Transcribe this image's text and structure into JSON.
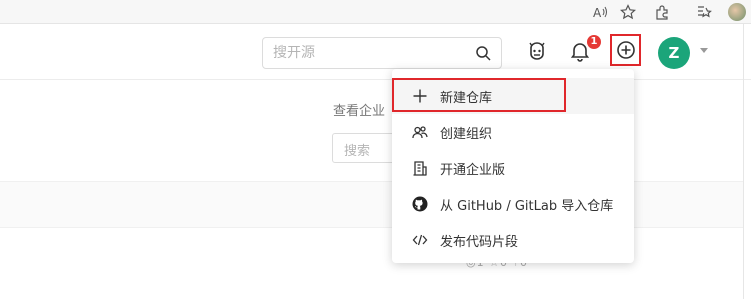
{
  "header": {
    "search_placeholder": "搜开源",
    "notification_count": "1",
    "user_initial": "Z"
  },
  "background": {
    "hint_text": "查看企业",
    "search_placeholder": "搜索",
    "stats": "◎1  ☆0  ⑂0"
  },
  "dropdown": {
    "items": [
      {
        "icon": "plus-icon",
        "label": "新建仓库"
      },
      {
        "icon": "people-icon",
        "label": "创建组织"
      },
      {
        "icon": "building-icon",
        "label": "开通企业版"
      },
      {
        "icon": "github-icon",
        "label": "从 GitHub / GitLab 导入仓库"
      },
      {
        "icon": "code-icon",
        "label": "发布代码片段"
      }
    ]
  },
  "colors": {
    "accent_red": "#e0272b",
    "avatar_green": "#1ba57a",
    "badge_red": "#e53935"
  }
}
